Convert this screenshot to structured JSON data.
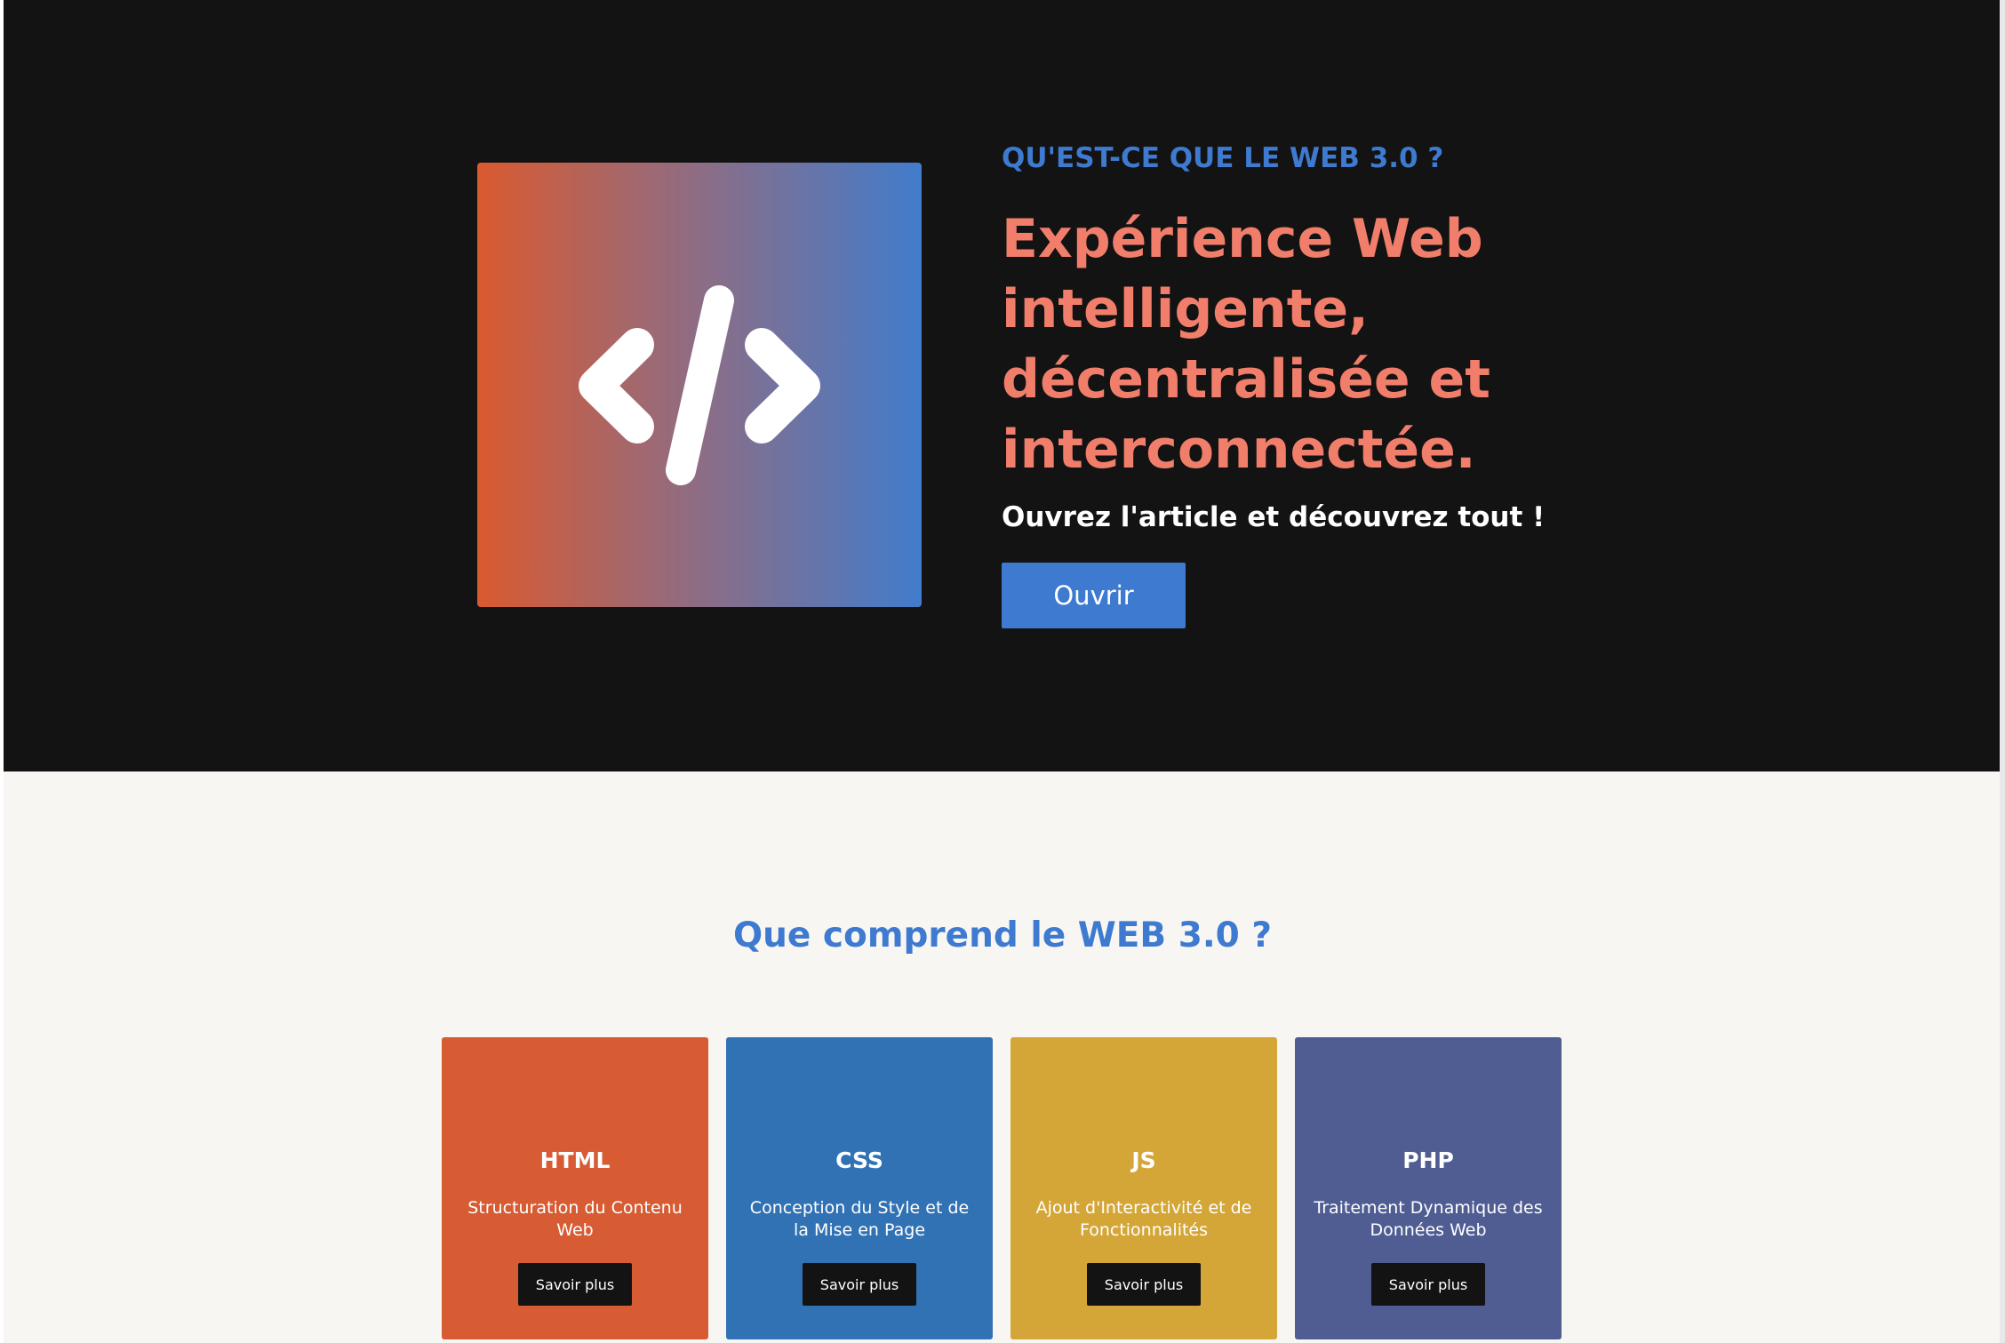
{
  "hero": {
    "eyebrow": "QU'EST-CE QUE LE WEB 3.0 ?",
    "headline": "Expérience Web intelligente, décentralisée et interconnectée.",
    "subline": "Ouvrez l'article et découvrez tout !",
    "cta_label": "Ouvrir",
    "image_icon": "code-brackets-icon",
    "image_gradient": [
      "#da5a30",
      "#8d6d85",
      "#417ccc"
    ]
  },
  "section": {
    "title": "Que comprend le WEB 3.0 ?"
  },
  "cards": [
    {
      "title": "HTML",
      "description": "Structuration du Contenu Web",
      "button_label": "Savoir plus",
      "color": "#d75b33"
    },
    {
      "title": "CSS",
      "description": "Conception du Style et de la Mise en Page",
      "button_label": "Savoir plus",
      "color": "#3172b5"
    },
    {
      "title": "JS",
      "description": "Ajout d'Interactivité et de Fonctionnalités",
      "button_label": "Savoir plus",
      "color": "#d4a637"
    },
    {
      "title": "PHP",
      "description": "Traitement Dynamique des Données Web",
      "button_label": "Savoir plus",
      "color": "#4f5d93"
    }
  ],
  "colors": {
    "dark_background": "#131313",
    "light_background": "#f8f6f3",
    "accent_blue": "#3d7ad0",
    "accent_coral": "#f17e6b"
  }
}
